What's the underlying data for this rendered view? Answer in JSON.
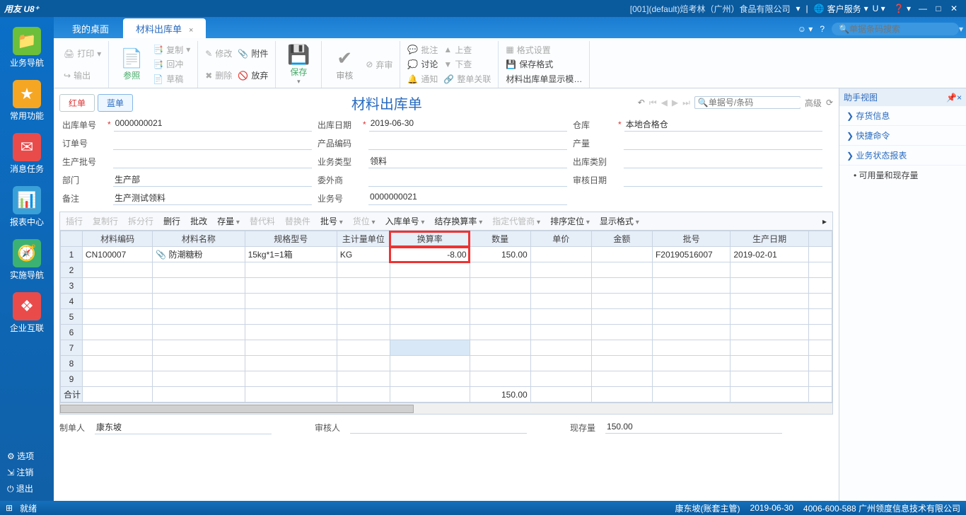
{
  "titlebar": {
    "logo": "用友 U8⁺",
    "company": "[001](default)焙考林（广州）食品有限公司",
    "service": "客户服务"
  },
  "tabs": {
    "desktop": "我的桌面",
    "doc": "材料出库单"
  },
  "search": {
    "placeholder": "单据条码搜索"
  },
  "leftnav": {
    "biz": "业务导航",
    "fav": "常用功能",
    "msg": "消息任务",
    "rpt": "报表中心",
    "impl": "实施导航",
    "ent": "企业互联",
    "opt": "选项",
    "logout": "注销",
    "exit": "退出"
  },
  "ribbon": {
    "print": "打印",
    "output": "输出",
    "ref": "参照",
    "copy": "复制",
    "flush": "回冲",
    "draft": "草稿",
    "modify": "修改",
    "delete": "删除",
    "attach": "附件",
    "giveup": "放弃",
    "save": "保存",
    "audit": "审核",
    "abandon": "弃审",
    "batchnote": "批注",
    "discuss": "讨论",
    "notify": "通知",
    "up": "上查",
    "down": "下查",
    "whole": "整单关联",
    "fmt": "格式设置",
    "savefmt": "保存格式",
    "dispmode": "材料出库单显示模…"
  },
  "pill": {
    "red": "红单",
    "blue": "蓝单"
  },
  "doc": {
    "title": "材料出库单",
    "search_ph": "单据号/条码",
    "adv": "高级"
  },
  "form": {
    "out_no_l": "出库单号",
    "out_no": "0000000021",
    "out_date_l": "出库日期",
    "out_date": "2019-06-30",
    "wh_l": "仓库",
    "wh": "本地合格仓",
    "order_l": "订单号",
    "prod_l": "产品编码",
    "qty_l": "产量",
    "batch_l": "生产批号",
    "biztype_l": "业务类型",
    "biztype": "领料",
    "outtype_l": "出库类别",
    "dept_l": "部门",
    "dept": "生产部",
    "outsrc_l": "委外商",
    "审核_l": "审核日期",
    "remark_l": "备注",
    "remark": "生产测试领料",
    "bizno_l": "业务号",
    "bizno": "0000000021"
  },
  "tbltb": {
    "insrow": "插行",
    "cprow": "复制行",
    "splitrow": "拆分行",
    "delrow": "删行",
    "batchmod": "批改",
    "stock": "存量",
    "repl": "替代料",
    "repp": "替换件",
    "batchno": "批号",
    "loc": "货位",
    "inno": "入库单号",
    "conv": "结存换算率",
    "keeper": "指定代管商",
    "sort": "排序定位",
    "disp": "显示格式"
  },
  "cols": {
    "matcode": "材料编码",
    "matname": "材料名称",
    "spec": "规格型号",
    "unit": "主计量单位",
    "rate": "换算率",
    "qty": "数量",
    "price": "单价",
    "amt": "金额",
    "batch": "批号",
    "pdate": "生产日期"
  },
  "rows": [
    {
      "n": "1",
      "code": "CN100007",
      "name": "防潮糖粉",
      "spec": "15kg*1=1箱",
      "unit": "KG",
      "rate": "-8.00",
      "qty": "150.00",
      "price": "",
      "amt": "",
      "batch": "F20190516007",
      "pdate": "2019-02-01"
    },
    {
      "n": "2"
    },
    {
      "n": "3"
    },
    {
      "n": "4"
    },
    {
      "n": "5"
    },
    {
      "n": "6"
    },
    {
      "n": "7"
    },
    {
      "n": "8"
    },
    {
      "n": "9"
    }
  ],
  "sum": {
    "label": "合计",
    "qty": "150.00"
  },
  "footer": {
    "maker_l": "制单人",
    "maker": "康东坡",
    "审核_l": "审核人",
    "stock_l": "现存量",
    "stock": "150.00"
  },
  "help": {
    "title": "助手视图",
    "inv": "存货信息",
    "cmd": "快捷命令",
    "rpt": "业务状态报表",
    "sub1": "• 可用量和现存量"
  },
  "status": {
    "ready": "就绪",
    "user": "康东坡(账套主管)",
    "date": "2019-06-30",
    "tel": "4006-600-588 广州领度信息技术有限公司"
  }
}
